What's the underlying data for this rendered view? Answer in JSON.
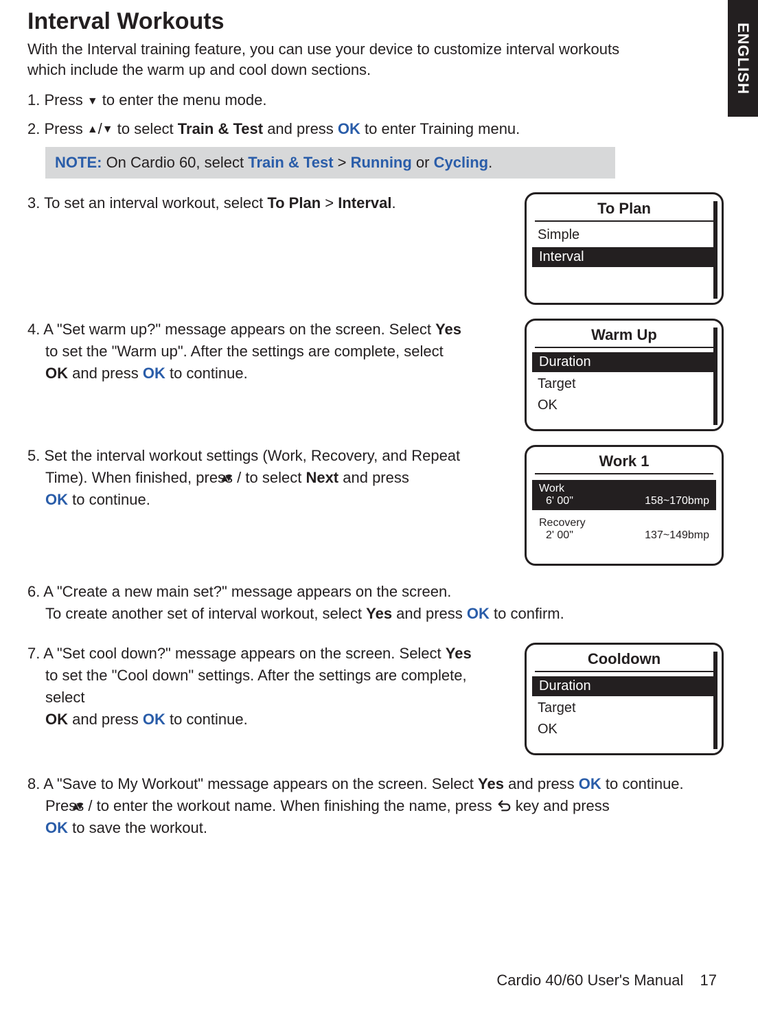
{
  "lang_tab": "ENGLISH",
  "title": "Interval Workouts",
  "intro": "With the Interval training feature, you can use your device to customize interval workouts which include the warm up and cool down sections.",
  "step1_a": "1. Press ",
  "step1_b": " to enter the menu mode.",
  "step2_a": "2. Press ",
  "step2_b": " to select ",
  "step2_bold1": "Train & Test",
  "step2_c": " and press ",
  "step2_ok": "OK",
  "step2_d": " to enter Training menu.",
  "note_label": "NOTE: ",
  "note_a": "On Cardio 60, select ",
  "note_train": "Train & Test",
  "note_gt": " > ",
  "note_run": "Running",
  "note_or": " or ",
  "note_cyc": "Cycling",
  "note_dot": ".",
  "step3_a": "3. To set an interval workout, select ",
  "step3_toplan": "To Plan",
  "step3_gt": " > ",
  "step3_interval": "Interval",
  "step3_dot": ".",
  "screen1": {
    "title": "To Plan",
    "row1": "Simple",
    "row2": "Interval"
  },
  "step4_a": "4. A \"Set warm up?\" message appears on the screen. Select ",
  "step4_yes": "Yes",
  "step4_b": " to set the \"Warm up\". After the settings are complete, select ",
  "step4_okbold": "OK",
  "step4_c": " and press ",
  "step4_okblue": "OK",
  "step4_d": " to continue.",
  "screen2": {
    "title": "Warm Up",
    "row1": "Duration",
    "row2": "Target",
    "row3": "OK"
  },
  "step5_a": "5. Set the interval workout settings (Work, Recovery, and Repeat Time).  When finished, press ",
  "step5_b": " to select ",
  "step5_next": "Next",
  "step5_c": " and press ",
  "step5_ok": "OK",
  "step5_d": " to continue.",
  "screen3": {
    "title": "Work 1",
    "work_label": "Work",
    "work_time": "6' 00\"",
    "work_bpm": "158~170bmp",
    "rec_label": "Recovery",
    "rec_time": "2' 00\"",
    "rec_bpm": "137~149bmp"
  },
  "step6_a": "6. A \"Create a new main set?\" message appears on the screen.",
  "step6_b": "To create another set of interval workout, select ",
  "step6_yes": "Yes",
  "step6_c": " and press ",
  "step6_ok": "OK",
  "step6_d": " to confirm.",
  "step7_a": "7. A \"Set cool down?\" message appears on the screen. Select ",
  "step7_yes": "Yes",
  "step7_b": " to set the \"Cool down\" settings. After the settings are complete, select ",
  "step7_okbold": "OK",
  "step7_c": " and press ",
  "step7_okblue": "OK",
  "step7_d": " to continue.",
  "screen4": {
    "title": "Cooldown",
    "row1": "Duration",
    "row2": "Target",
    "row3": "OK"
  },
  "step8_a": "8. A \"Save to My Workout\" message appears on the screen. Select ",
  "step8_yes": "Yes",
  "step8_b": " and press ",
  "step8_ok1": "OK",
  "step8_c": " to continue. Press ",
  "step8_d": " to enter the workout name. When finishing the name, press ",
  "step8_e": " key and press ",
  "step8_ok2": "OK",
  "step8_f": " to save the workout.",
  "footer_text": "Cardio 40/60 User's Manual",
  "page_num": "17"
}
